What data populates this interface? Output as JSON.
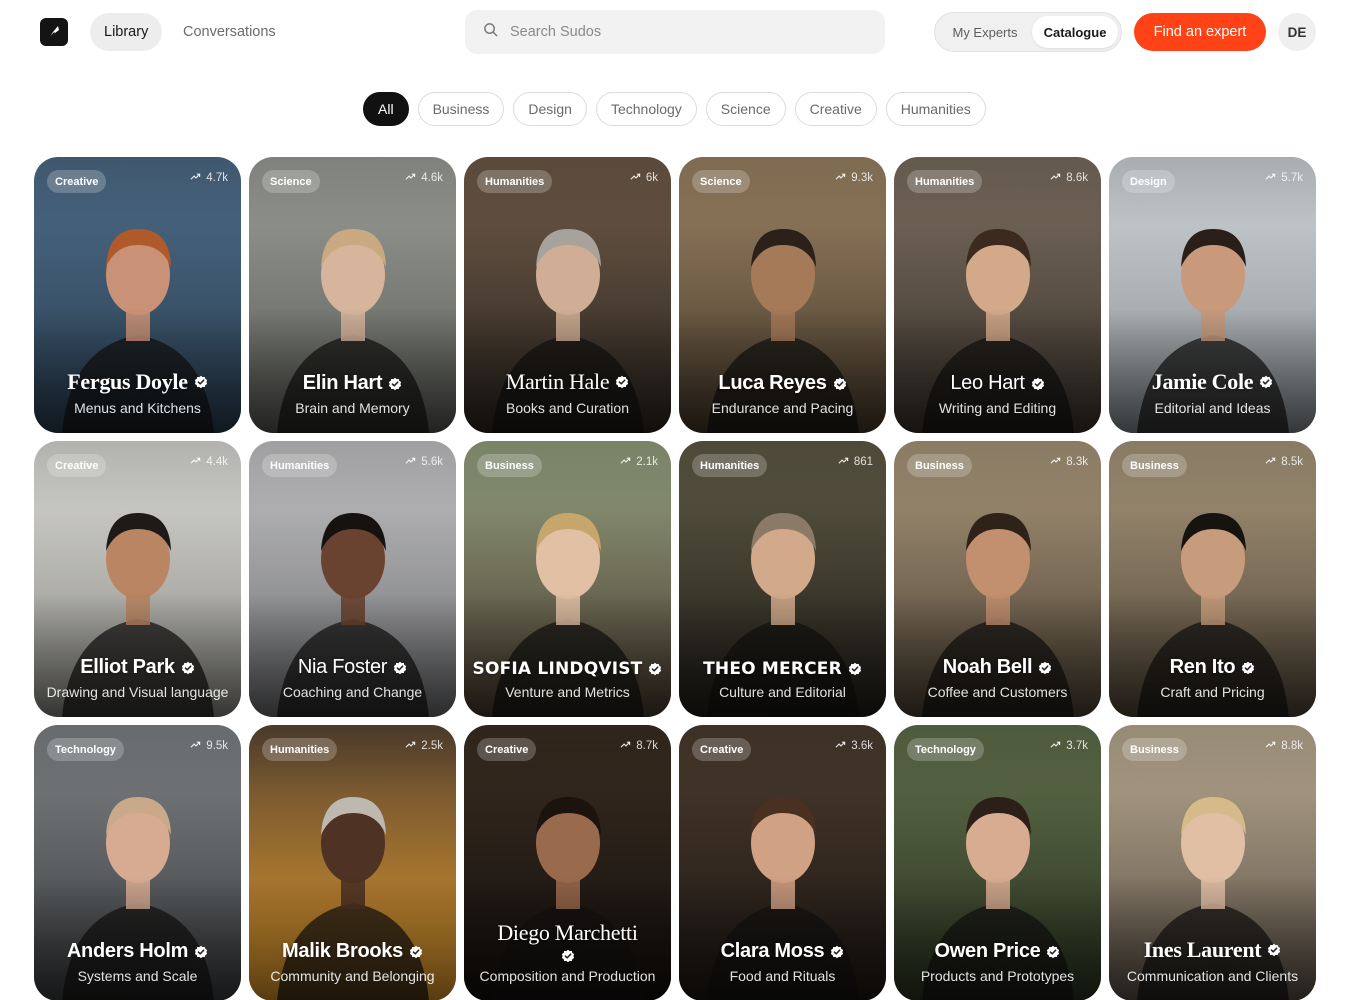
{
  "header": {
    "logo_icon": "feather-logo-icon",
    "nav": [
      {
        "label": "Library",
        "active": true
      },
      {
        "label": "Conversations",
        "active": false
      }
    ],
    "search": {
      "placeholder": "Search Sudos",
      "value": ""
    },
    "segment": {
      "experts_label": "My Experts",
      "catalogue_label": "Catalogue",
      "selected": "Catalogue"
    },
    "cta_label": "Find an expert",
    "avatar_initials": "DE",
    "colors": {
      "accent": "#ff4316",
      "chip_active": "#111111"
    }
  },
  "filters": [
    "All",
    "Business",
    "Design",
    "Technology",
    "Science",
    "Creative",
    "Humanities"
  ],
  "active_filter": "All",
  "experts": [
    {
      "name": "Fergus Doyle",
      "subtitle": "Menus and Kitchens",
      "category": "Creative",
      "count": "4.7k",
      "bg": [
        "#4d6b86",
        "#2a3f52"
      ],
      "skin": "#c99277",
      "hair": "#b05a2c"
    },
    {
      "name": "Elin Hart",
      "subtitle": "Brain and Memory",
      "category": "Science",
      "count": "4.6k",
      "bg": [
        "#9b9e97",
        "#5a5c57"
      ],
      "skin": "#d7b49c",
      "hair": "#c9aa80"
    },
    {
      "name": "Martin Hale",
      "subtitle": "Books and Curation",
      "category": "Humanities",
      "count": "6k",
      "bg": [
        "#6e5a48",
        "#2c2620"
      ],
      "skin": "#cfae95",
      "hair": "#a7a29a"
    },
    {
      "name": "Luca Reyes",
      "subtitle": "Endurance and Pacing",
      "category": "Science",
      "count": "9.3k",
      "bg": [
        "#9a8263",
        "#463a2b"
      ],
      "skin": "#a57a58",
      "hair": "#2b2118"
    },
    {
      "name": "Leo Hart",
      "subtitle": "Writing and Editing",
      "category": "Humanities",
      "count": "8.6k",
      "bg": [
        "#7a6d5e",
        "#3a332c"
      ],
      "skin": "#d4a98a",
      "hair": "#3b2a1d"
    },
    {
      "name": "Jamie Cole",
      "subtitle": "Editorial and Ideas",
      "category": "Design",
      "count": "5.7k",
      "bg": [
        "#cdd3d6",
        "#8a9094"
      ],
      "skin": "#c89a7b",
      "hair": "#2a1f18"
    },
    {
      "name": "Elliot Park",
      "subtitle": "Drawing and Visual language",
      "category": "Creative",
      "count": "4.4k",
      "bg": [
        "#d8d8d4",
        "#8e8d87"
      ],
      "skin": "#b98563",
      "hair": "#1e1a17"
    },
    {
      "name": "Nia Foster",
      "subtitle": "Coaching and Change",
      "category": "Humanities",
      "count": "5.6k",
      "bg": [
        "#c2c2c4",
        "#6f7072"
      ],
      "skin": "#6a4330",
      "hair": "#161210"
    },
    {
      "name": "SOFIA LINDQVIST",
      "subtitle": "Venture and Metrics",
      "category": "Business",
      "count": "2.1k",
      "bg": [
        "#93a07e",
        "#4a3c30"
      ],
      "skin": "#e1c0a4",
      "hair": "#c7a66c"
    },
    {
      "name": "THEO MERCER",
      "subtitle": "Culture and Editorial",
      "category": "Humanities",
      "count": "861",
      "bg": [
        "#5f5a45",
        "#1f1d18"
      ],
      "skin": "#d2a98b",
      "hair": "#8c7a68"
    },
    {
      "name": "Noah Bell",
      "subtitle": "Coffee and Customers",
      "category": "Business",
      "count": "8.3k",
      "bg": [
        "#a8967a",
        "#4d4234"
      ],
      "skin": "#c28f6f",
      "hair": "#2e2219"
    },
    {
      "name": "Ren Ito",
      "subtitle": "Craft and Pricing",
      "category": "Business",
      "count": "8.5k",
      "bg": [
        "#a6957a",
        "#524738"
      ],
      "skin": "#c79c7c",
      "hair": "#17130f"
    },
    {
      "name": "Anders Holm",
      "subtitle": "Systems and Scale",
      "category": "Technology",
      "count": "9.5k",
      "bg": [
        "#7e8285",
        "#3b3d3f"
      ],
      "skin": "#d6ab92",
      "hair": "#c9a98a"
    },
    {
      "name": "Malik Brooks",
      "subtitle": "Community and Belonging",
      "category": "Humanities",
      "count": "2.5k",
      "bg": [
        "#5a4633",
        "#e39a2a"
      ],
      "skin": "#4e3224",
      "hair": "#bdb8b0"
    },
    {
      "name": "Diego Marchetti",
      "subtitle": "Composition and Production",
      "category": "Creative",
      "count": "8.7k",
      "bg": [
        "#3a2d22",
        "#120e0b"
      ],
      "skin": "#9a6a4d",
      "hair": "#1a130e"
    },
    {
      "name": "Clara Moss",
      "subtitle": "Food and Rituals",
      "category": "Creative",
      "count": "3.6k",
      "bg": [
        "#4b3b2e",
        "#1c1612"
      ],
      "skin": "#d1a184",
      "hair": "#4a3020"
    },
    {
      "name": "Owen Price",
      "subtitle": "Products and Prototypes",
      "category": "Technology",
      "count": "3.7k",
      "bg": [
        "#5f6e4a",
        "#2a3320"
      ],
      "skin": "#d8ac90",
      "hair": "#2b1f17"
    },
    {
      "name": "Ines Laurent",
      "subtitle": "Communication and Clients",
      "category": "Business",
      "count": "8.8k",
      "bg": [
        "#b8a98f",
        "#5a5046"
      ],
      "skin": "#e0bfa5",
      "hair": "#d6bb8a"
    }
  ]
}
